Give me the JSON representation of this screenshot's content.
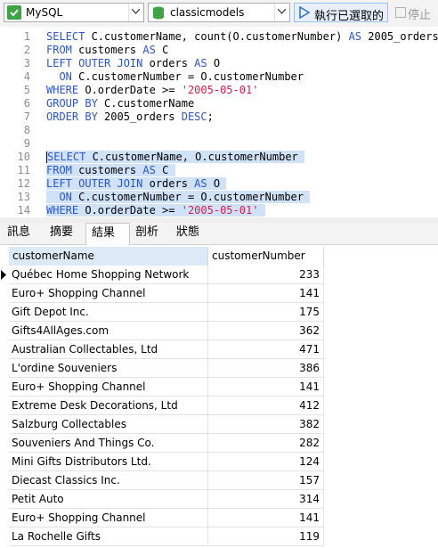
{
  "toolbar": {
    "connection": "MySQL",
    "database": "classicmodels",
    "run_selected_label": "執行已選取的",
    "stop_label": "停止",
    "colors": {
      "mysql": "#3aa542",
      "db": "#3aa542",
      "run": "#2b6fd6"
    }
  },
  "editor": {
    "lines": [
      {
        "n": "1",
        "text": "SELECT C.customerName, count(O.customerNumber) AS 2005_orders"
      },
      {
        "n": "2",
        "text": "FROM customers AS C"
      },
      {
        "n": "3",
        "text": "LEFT OUTER JOIN orders AS O"
      },
      {
        "n": "4",
        "text": "  ON C.customerNumber = O.customerNumber"
      },
      {
        "n": "5",
        "text": "WHERE O.orderDate >= '2005-05-01'"
      },
      {
        "n": "6",
        "text": "GROUP BY C.customerName"
      },
      {
        "n": "7",
        "text": "ORDER BY 2005_orders DESC;"
      },
      {
        "n": "8",
        "text": ""
      },
      {
        "n": "9",
        "text": ""
      },
      {
        "n": "10",
        "text": "SELECT C.customerName, O.customerNumber"
      },
      {
        "n": "11",
        "text": "FROM customers AS C"
      },
      {
        "n": "12",
        "text": "LEFT OUTER JOIN orders AS O"
      },
      {
        "n": "13",
        "text": "  ON C.customerNumber = O.customerNumber"
      },
      {
        "n": "14",
        "text": "WHERE O.orderDate >= '2005-05-01'"
      }
    ]
  },
  "tabs": [
    {
      "label": "訊息"
    },
    {
      "label": "摘要"
    },
    {
      "label": "結果 1"
    },
    {
      "label": "剖析"
    },
    {
      "label": "狀態"
    }
  ],
  "grid": {
    "columns": [
      "customerName",
      "customerNumber"
    ],
    "rows": [
      [
        "Québec Home Shopping Network",
        "233"
      ],
      [
        "Euro+ Shopping Channel",
        "141"
      ],
      [
        "Gift Depot Inc.",
        "175"
      ],
      [
        "Gifts4AllAges.com",
        "362"
      ],
      [
        "Australian Collectables, Ltd",
        "471"
      ],
      [
        "L'ordine Souveniers",
        "386"
      ],
      [
        "Euro+ Shopping Channel",
        "141"
      ],
      [
        "Extreme Desk Decorations, Ltd",
        "412"
      ],
      [
        "Salzburg Collectables",
        "382"
      ],
      [
        "Souveniers And Things Co.",
        "282"
      ],
      [
        "Mini Gifts Distributors Ltd.",
        "124"
      ],
      [
        "Diecast Classics Inc.",
        "157"
      ],
      [
        "Petit Auto",
        "314"
      ],
      [
        "Euro+ Shopping Channel",
        "141"
      ],
      [
        "La Rochelle Gifts",
        "119"
      ]
    ]
  }
}
